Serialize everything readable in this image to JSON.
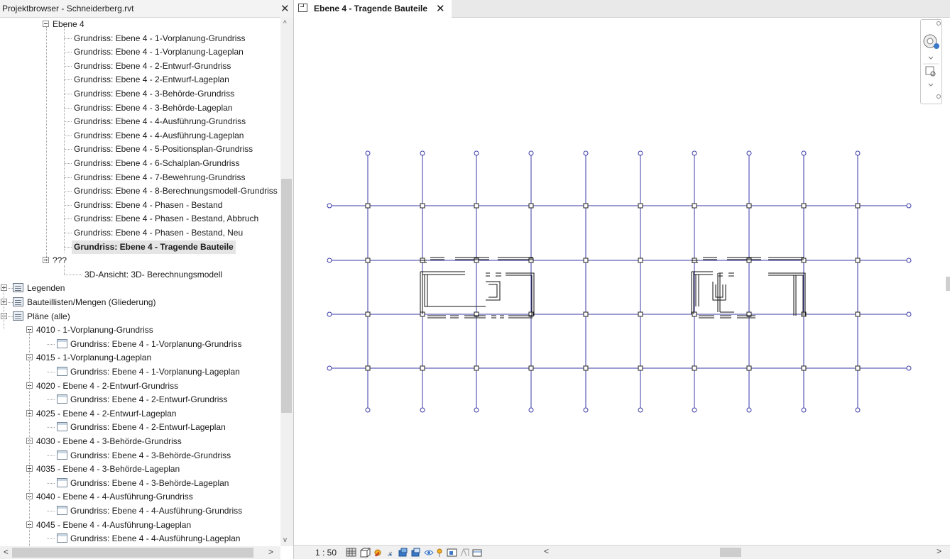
{
  "project_browser": {
    "title": "Projektbrowser - Schneiderberg.rvt",
    "close_label": "✕",
    "items": [
      {
        "label": "Ebene 4",
        "kind": "folder-open"
      },
      {
        "label": "Grundriss: Ebene 4 - 1-Vorplanung-Grundriss",
        "kind": "view"
      },
      {
        "label": "Grundriss: Ebene 4 - 1-Vorplanung-Lageplan",
        "kind": "view"
      },
      {
        "label": "Grundriss: Ebene 4 - 2-Entwurf-Grundriss",
        "kind": "view"
      },
      {
        "label": "Grundriss: Ebene 4 - 2-Entwurf-Lageplan",
        "kind": "view"
      },
      {
        "label": "Grundriss: Ebene 4 - 3-Behörde-Grundriss",
        "kind": "view"
      },
      {
        "label": "Grundriss: Ebene 4 - 3-Behörde-Lageplan",
        "kind": "view"
      },
      {
        "label": "Grundriss: Ebene 4 - 4-Ausführung-Grundriss",
        "kind": "view"
      },
      {
        "label": "Grundriss: Ebene 4 - 4-Ausführung-Lageplan",
        "kind": "view"
      },
      {
        "label": "Grundriss: Ebene 4 - 5-Positionsplan-Grundriss",
        "kind": "view"
      },
      {
        "label": "Grundriss: Ebene 4 - 6-Schalplan-Grundriss",
        "kind": "view"
      },
      {
        "label": "Grundriss: Ebene 4 - 7-Bewehrung-Grundriss",
        "kind": "view"
      },
      {
        "label": "Grundriss: Ebene 4 - 8-Berechnungsmodell-Grundriss",
        "kind": "view"
      },
      {
        "label": "Grundriss: Ebene 4 - Phasen - Bestand",
        "kind": "view"
      },
      {
        "label": "Grundriss: Ebene 4 - Phasen - Bestand, Abbruch",
        "kind": "view"
      },
      {
        "label": "Grundriss: Ebene 4 - Phasen - Bestand, Neu",
        "kind": "view"
      },
      {
        "label": "Grundriss: Ebene 4 - Tragende Bauteile",
        "kind": "view-active"
      },
      {
        "label": "???",
        "kind": "folder-open"
      },
      {
        "label": "3D-Ansicht: 3D- Berechnungsmodell",
        "kind": "view"
      },
      {
        "label": "Legenden",
        "kind": "category"
      },
      {
        "label": "Bauteillisten/Mengen (Gliederung)",
        "kind": "category"
      },
      {
        "label": "Pläne (alle)",
        "kind": "category-open"
      },
      {
        "label": "4010 - 1-Vorplanung-Grundriss",
        "kind": "sheet-folder"
      },
      {
        "label": "Grundriss: Ebene 4 - 1-Vorplanung-Grundriss",
        "kind": "sheet-view"
      },
      {
        "label": "4015 - 1-Vorplanung-Lageplan",
        "kind": "sheet-folder"
      },
      {
        "label": "Grundriss: Ebene 4 - 1-Vorplanung-Lageplan",
        "kind": "sheet-view"
      },
      {
        "label": "4020 - Ebene 4 - 2-Entwurf-Grundriss",
        "kind": "sheet-folder"
      },
      {
        "label": "Grundriss: Ebene 4 - 2-Entwurf-Grundriss",
        "kind": "sheet-view"
      },
      {
        "label": "4025 - Ebene 4 - 2-Entwurf-Lageplan",
        "kind": "sheet-folder"
      },
      {
        "label": "Grundriss: Ebene 4 - 2-Entwurf-Lageplan",
        "kind": "sheet-view"
      },
      {
        "label": "4030 - Ebene 4 - 3-Behörde-Grundriss",
        "kind": "sheet-folder"
      },
      {
        "label": "Grundriss: Ebene 4 - 3-Behörde-Grundriss",
        "kind": "sheet-view"
      },
      {
        "label": "4035 - Ebene 4 - 3-Behörde-Lageplan",
        "kind": "sheet-folder"
      },
      {
        "label": "Grundriss: Ebene 4 - 3-Behörde-Lageplan",
        "kind": "sheet-view"
      },
      {
        "label": "4040 - Ebene 4 - 4-Ausführung-Grundriss",
        "kind": "sheet-folder"
      },
      {
        "label": "Grundriss: Ebene 4 - 4-Ausführung-Grundriss",
        "kind": "sheet-view"
      },
      {
        "label": "4045 - Ebene 4 - 4-Ausführung-Lageplan",
        "kind": "sheet-folder"
      },
      {
        "label": "Grundriss: Ebene 4 - 4-Ausführung-Lageplan",
        "kind": "sheet-view"
      }
    ]
  },
  "view_tab": {
    "label": "Ebene 4 - Tragende Bauteile",
    "close_label": "✕",
    "icon": "floor-plan-icon"
  },
  "status_bar": {
    "scale": "1 : 50",
    "icons": [
      "detail-level-icon",
      "visual-style-icon",
      "sun-path-icon",
      "shadows-icon",
      "crop-view-icon",
      "show-crop-icon",
      "temporary-hide-icon",
      "reveal-hidden-icon",
      "analytical-model-icon",
      "highlight-displacement-icon",
      "constraints-icon"
    ]
  },
  "navigation_bar": {
    "icons": [
      "steering-wheel-icon",
      "zoom-region-icon"
    ]
  },
  "colors": {
    "grid_line": "#3a3aa8",
    "wall_line": "#111111",
    "panel_bg": "#f0f0f0"
  }
}
